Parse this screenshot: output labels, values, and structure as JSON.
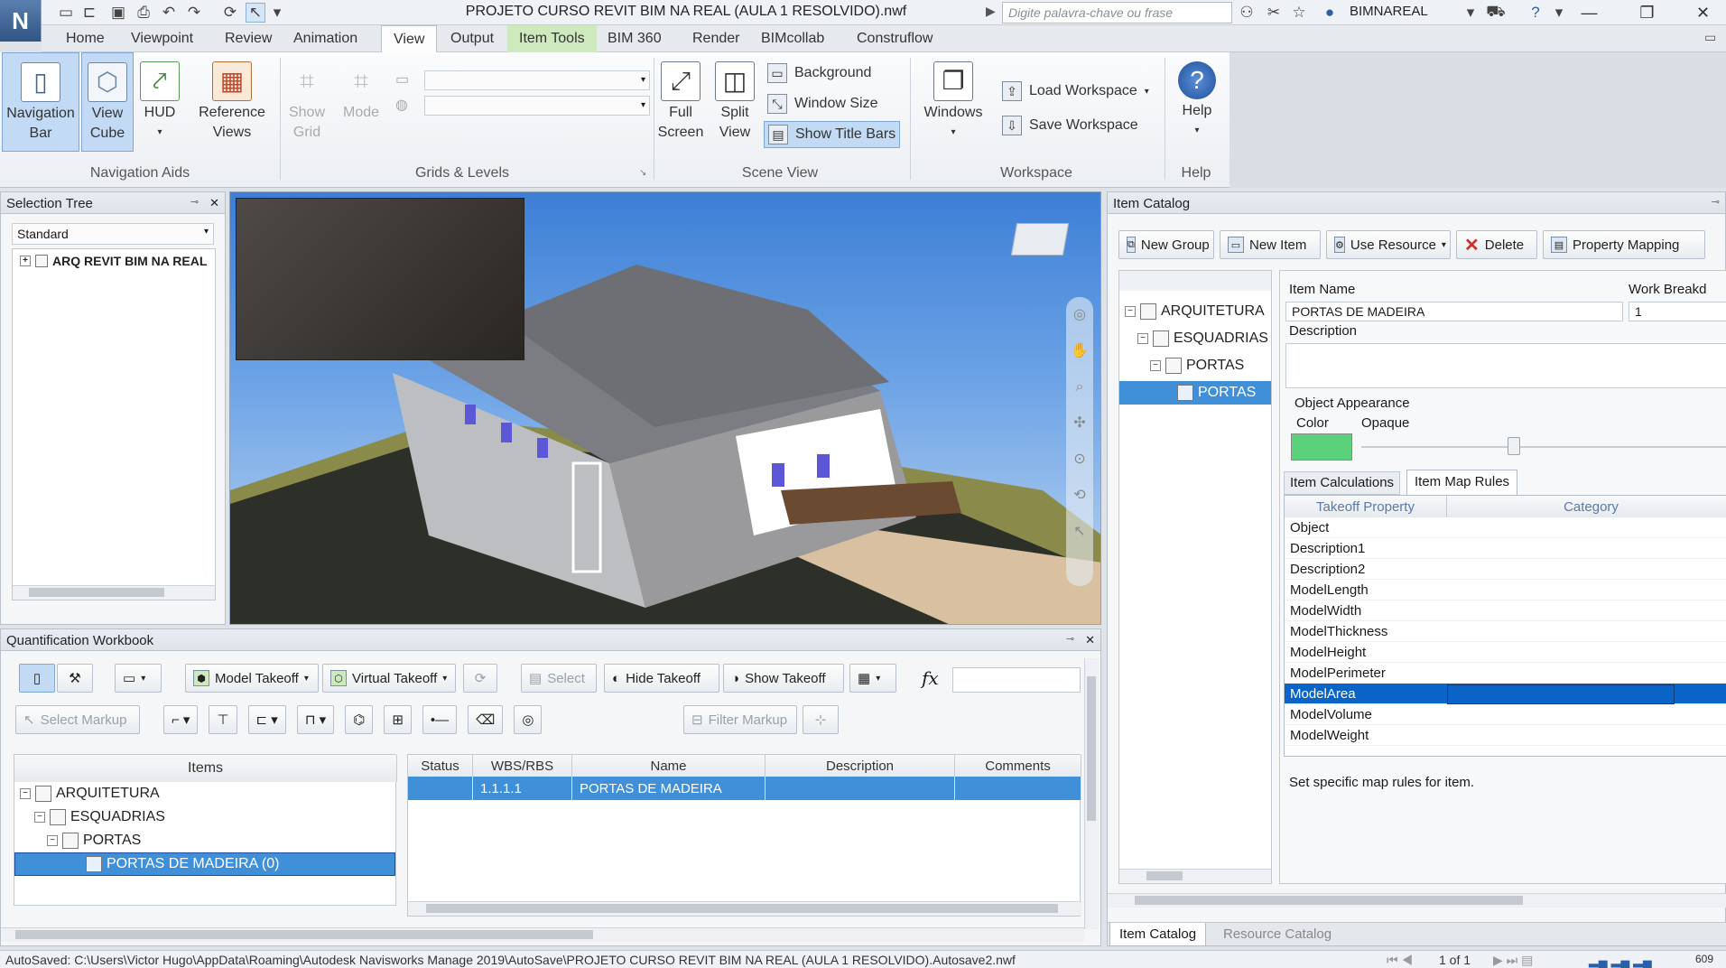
{
  "app": {
    "logo": "N",
    "title": "PROJETO  CURSO REVIT BIM NA REAL (AULA 1 RESOLVIDO).nwf",
    "search_placeholder": "Digite palavra-chave ou frase",
    "user": "BIMNAREAL"
  },
  "menu": {
    "tabs": [
      "Home",
      "Viewpoint",
      "Review",
      "Animation",
      "View",
      "Output",
      "Item Tools",
      "BIM 360",
      "Render",
      "BIMcollab",
      "Construflow"
    ],
    "active": "View"
  },
  "ribbon": {
    "navigation_bar": "Navigation\nBar",
    "view_cube": "View\nCube",
    "hud": "HUD",
    "reference_views": "Reference\nViews",
    "show_grid": "Show\nGrid",
    "mode": "Mode",
    "full_screen": "Full\nScreen",
    "split_view": "Split\nView",
    "background": "Background",
    "window_size": "Window Size",
    "show_title_bars": "Show Title Bars",
    "windows": "Windows",
    "load_workspace": "Load Workspace",
    "save_workspace": "Save Workspace",
    "help": "Help",
    "groups": {
      "navigation_aids": "Navigation Aids",
      "grids_levels": "Grids & Levels",
      "scene_view": "Scene View",
      "workspace": "Workspace",
      "help": "Help"
    }
  },
  "selection_tree": {
    "title": "Selection Tree",
    "dropdown": "Standard",
    "root": "ARQ REVIT BIM NA REAL"
  },
  "workbook": {
    "title": "Quantification Workbook",
    "buttons": {
      "model_takeoff": "Model Takeoff",
      "virtual_takeoff": "Virtual Takeoff",
      "select": "Select",
      "hide_takeoff": "Hide Takeoff",
      "show_takeoff": "Show Takeoff",
      "select_markup": "Select Markup",
      "filter_markup": "Filter Markup",
      "fx": "fx"
    },
    "items_header": "Items",
    "tree": [
      "ARQUITETURA",
      "ESQUADRIAS",
      "PORTAS",
      "PORTAS DE MADEIRA (0)"
    ],
    "columns": [
      "Status",
      "WBS/RBS",
      "Name",
      "Description",
      "Comments"
    ],
    "rows": [
      {
        "status": "",
        "wbs": "1.1.1.1",
        "name": "PORTAS DE MADEIRA",
        "description": "",
        "comments": ""
      }
    ]
  },
  "item_catalog": {
    "title": "Item Catalog",
    "buttons": {
      "new_group": "New Group",
      "new_item": "New Item",
      "use_resource": "Use Resource",
      "delete": "Delete",
      "property_mapping": "Property Mapping"
    },
    "tree": [
      "ARQUITETURA",
      "ESQUADRIAS",
      "PORTAS",
      "PORTAS"
    ],
    "item_name_label": "Item Name",
    "item_name_value": "PORTAS DE MADEIRA",
    "work_breakdown_label": "Work Breakd",
    "work_breakdown_value": "1",
    "description_label": "Description",
    "object_appearance_label": "Object Appearance",
    "color_label": "Color",
    "opaque_label": "Opaque",
    "color_value": "#5ad17a",
    "tabs": [
      "Item Calculations",
      "Item Map Rules"
    ],
    "active_tab": "Item Map Rules",
    "map_columns": [
      "Takeoff Property",
      "Category"
    ],
    "properties": [
      "Object",
      "Description1",
      "Description2",
      "ModelLength",
      "ModelWidth",
      "ModelThickness",
      "ModelHeight",
      "ModelPerimeter",
      "ModelArea",
      "ModelVolume",
      "ModelWeight"
    ],
    "selected_property": "ModelArea",
    "hint": "Set specific map rules for item.",
    "bottom_tabs": [
      "Item Catalog",
      "Resource Catalog"
    ]
  },
  "status_bar": {
    "text": "AutoSaved: C:\\Users\\Victor Hugo\\AppData\\Roaming\\Autodesk Navisworks Manage 2019\\AutoSave\\PROJETO  CURSO REVIT BIM NA REAL (AULA 1 RESOLVIDO).Autosave2.nwf",
    "page": "1 of 1",
    "memory": "609"
  },
  "colors": {
    "accent": "#0a64c8",
    "selection": "#3f8fd9",
    "ribbon_sel": "#c3daf4"
  }
}
